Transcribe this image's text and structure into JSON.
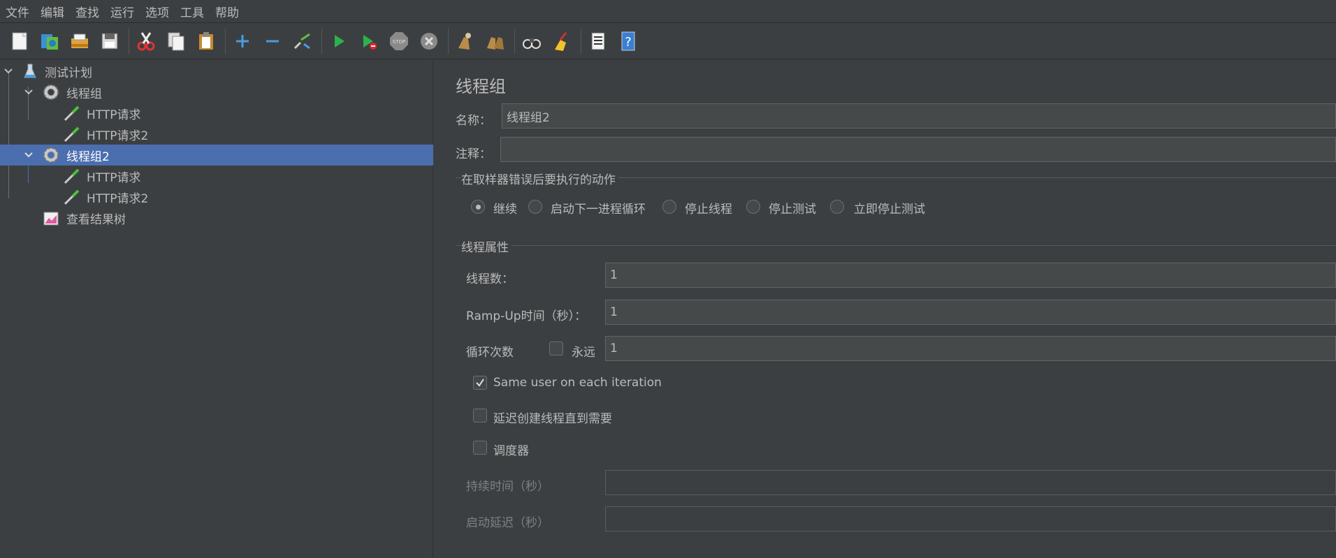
{
  "menu": [
    "文件",
    "编辑",
    "查找",
    "运行",
    "选项",
    "工具",
    "帮助"
  ],
  "toolbar_icons": [
    "new-icon",
    "templates-icon",
    "open-icon",
    "save-icon",
    "cut-icon",
    "copy-icon",
    "paste-icon",
    "expand-icon",
    "collapse-icon",
    "toggle-icon",
    "start-icon",
    "start-no-pause-icon",
    "stop-icon",
    "shutdown-icon",
    "clear-icon",
    "clear-all-icon",
    "search-icon",
    "reset-search-icon",
    "function-helper-icon",
    "help-icon"
  ],
  "tree": {
    "items": [
      {
        "label": "测试计划",
        "icon": "test-plan-icon"
      },
      {
        "label": "线程组",
        "icon": "thread-group-icon"
      },
      {
        "label": "HTTP请求",
        "icon": "http-sampler-icon"
      },
      {
        "label": "HTTP请求2",
        "icon": "http-sampler-icon"
      },
      {
        "label": "线程组2",
        "icon": "thread-group-icon"
      },
      {
        "label": "HTTP请求",
        "icon": "http-sampler-icon"
      },
      {
        "label": "HTTP请求2",
        "icon": "http-sampler-icon"
      },
      {
        "label": "查看结果树",
        "icon": "result-tree-icon"
      }
    ],
    "selected_index": 4
  },
  "panel": {
    "title": "线程组",
    "name_label": "名称：",
    "name_value": "线程组2",
    "comment_label": "注释：",
    "comment_value": "",
    "error_group_title": "在取样器错误后要执行的动作",
    "error_actions": [
      "继续",
      "启动下一进程循环",
      "停止线程",
      "停止测试",
      "立即停止测试"
    ],
    "error_action_selected": 0,
    "props_group_title": "线程属性",
    "threads_label": "线程数：",
    "threads_value": "1",
    "rampup_label": "Ramp-Up时间（秒）：",
    "rampup_value": "1",
    "loop_label": "循环次数",
    "forever_label": "永远",
    "forever_checked": false,
    "loop_value": "1",
    "same_user_label": "Same user on each iteration",
    "same_user_checked": true,
    "delay_label": "延迟创建线程直到需要",
    "delay_checked": false,
    "scheduler_label": "调度器",
    "scheduler_checked": false,
    "duration_label": "持续时间（秒）",
    "duration_value": "",
    "startup_delay_label": "启动延迟（秒）",
    "startup_delay_value": ""
  }
}
